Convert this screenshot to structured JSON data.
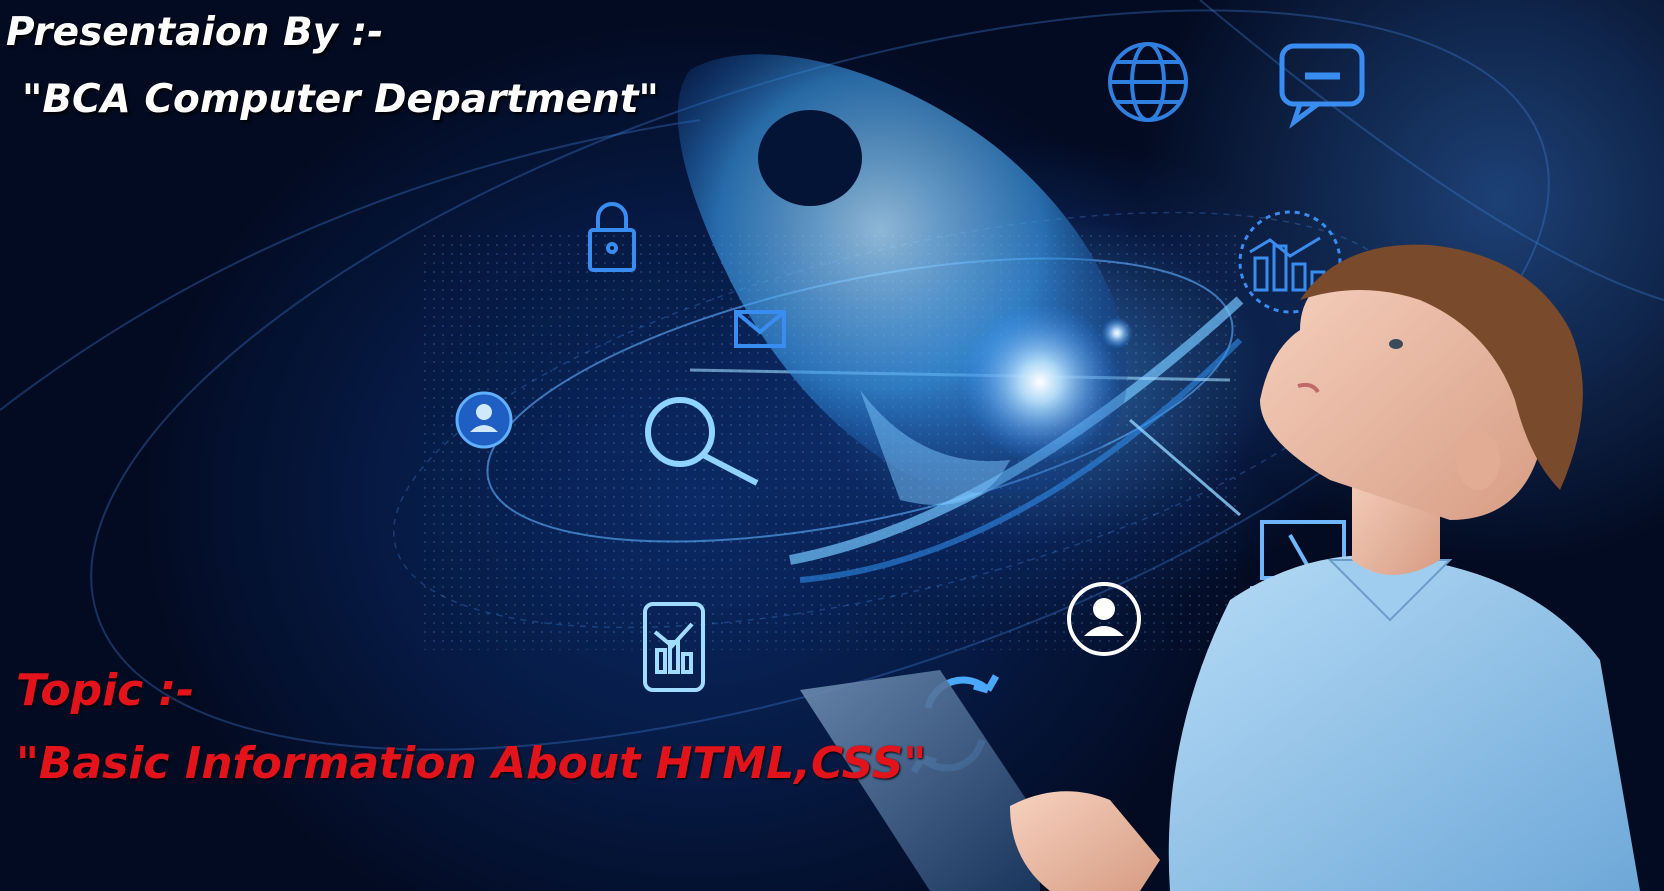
{
  "slide": {
    "presenter_label": "Presentaion By :-",
    "presenter_name": "\"BCA Computer Department\"",
    "topic_label": "Topic :-",
    "topic_title": "\"Basic Information About HTML,CSS\""
  },
  "colors": {
    "background": "#061a44",
    "glow": "#66c8ff",
    "icon_blue": "#2f7fe0",
    "heading_white": "#ffffff",
    "topic_red": "#e3131b",
    "shirt_blue": "#8cc2ea"
  },
  "icons": [
    "globe-icon",
    "chat-icon",
    "lock-icon",
    "mail-icon",
    "bar-chart-icon",
    "user-icon",
    "search-icon",
    "phone-chart-icon",
    "user-circle-icon",
    "laptop-icon",
    "refresh-icon",
    "rocket-icon"
  ]
}
